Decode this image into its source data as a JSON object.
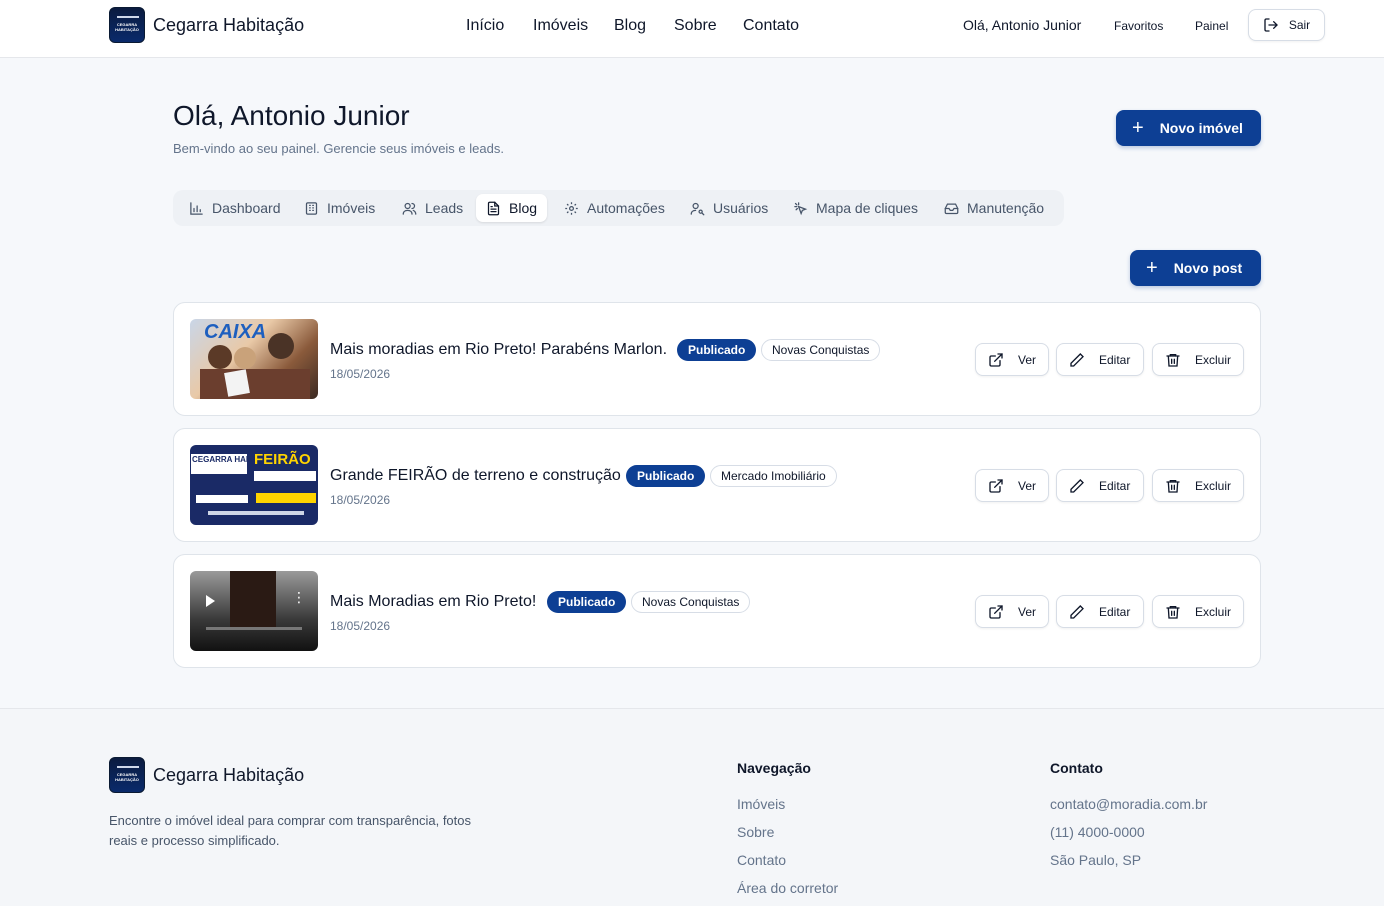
{
  "brand": {
    "name": "Cegarra Habitação",
    "logo_text": "CEGARRA HABITAÇÃO"
  },
  "nav": [
    {
      "label": "Início"
    },
    {
      "label": "Imóveis"
    },
    {
      "label": "Blog"
    },
    {
      "label": "Sobre"
    },
    {
      "label": "Contato"
    }
  ],
  "header": {
    "greeting": "Olá, Antonio Junior",
    "favorites": "Favoritos",
    "panel": "Painel",
    "logout": "Sair"
  },
  "page": {
    "title": "Olá, Antonio Junior",
    "subtitle": "Bem-vindo ao seu painel. Gerencie seus imóveis e leads.",
    "new_property": "Novo imóvel",
    "new_post": "Novo post"
  },
  "tabs": [
    {
      "label": "Dashboard",
      "icon": "bar-chart-icon"
    },
    {
      "label": "Imóveis",
      "icon": "building-icon"
    },
    {
      "label": "Leads",
      "icon": "users-icon"
    },
    {
      "label": "Blog",
      "icon": "document-icon",
      "active": true
    },
    {
      "label": "Automações",
      "icon": "gear-icon"
    },
    {
      "label": "Usuários",
      "icon": "user-key-icon"
    },
    {
      "label": "Mapa de cliques",
      "icon": "pointer-click-icon"
    },
    {
      "label": "Manutenção",
      "icon": "inbox-icon"
    }
  ],
  "posts": [
    {
      "title": "Mais moradias em Rio Preto! Parabéns Marlon.",
      "status": "Publicado",
      "category": "Novas Conquistas",
      "date": "18/05/2026",
      "thumb_text": "CAIXA"
    },
    {
      "title": "Grande FEIRÃO de terreno e construção",
      "status": "Publicado",
      "category": "Mercado Imobiliário",
      "date": "18/05/2026",
      "thumb_text": "FEIRÃO"
    },
    {
      "title": "Mais Moradias em Rio Preto!",
      "status": "Publicado",
      "category": "Novas Conquistas",
      "date": "18/05/2026",
      "thumb_text": ""
    }
  ],
  "actions": {
    "view": "Ver",
    "edit": "Editar",
    "delete": "Excluir"
  },
  "footer": {
    "description": "Encontre o imóvel ideal para comprar com transparência, fotos reais e processo simplificado.",
    "nav_heading": "Navegação",
    "nav_items": [
      "Imóveis",
      "Sobre",
      "Contato",
      "Área do corretor"
    ],
    "contact_heading": "Contato",
    "contact_items": [
      "contato@moradia.com.br",
      "(11) 4000-0000",
      "São Paulo, SP"
    ]
  },
  "colors": {
    "primary": "#0d3f94",
    "background": "#f6f8fb"
  }
}
